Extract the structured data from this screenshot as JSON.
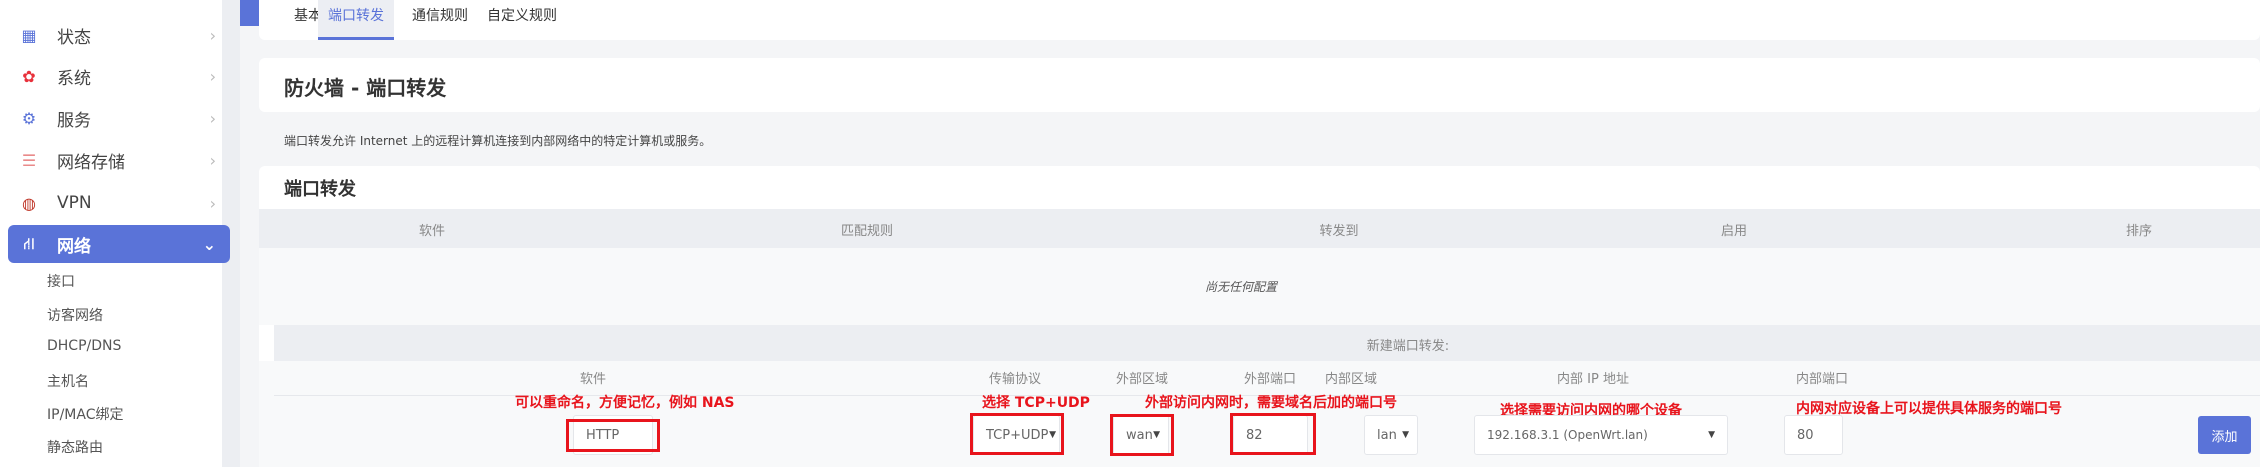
{
  "sidebar": {
    "items": [
      {
        "label": "状态",
        "icon": "dashboard-icon",
        "color": "#5a73d8"
      },
      {
        "label": "系统",
        "icon": "gear-icon",
        "color": "#e8313b"
      },
      {
        "label": "服务",
        "icon": "services-icon",
        "color": "#5a73d8"
      },
      {
        "label": "网络存储",
        "icon": "storage-icon",
        "color": "#e98a8a"
      },
      {
        "label": "VPN",
        "icon": "vpn-icon",
        "color": "#c0392b"
      },
      {
        "label": "网络",
        "icon": "network-icon",
        "color": "#ffffff"
      }
    ],
    "subitems": [
      "接口",
      "访客网络",
      "DHCP/DNS",
      "主机名",
      "IP/MAC绑定",
      "静态路由"
    ]
  },
  "tabs": [
    "基本设置",
    "端口转发",
    "通信规则",
    "自定义规则"
  ],
  "page_title": "防火墙 - 端口转发",
  "description": "端口转发允许 Internet 上的远程计算机连接到内部网络中的特定计算机或服务。",
  "section_title": "端口转发",
  "table": {
    "headers": [
      "软件",
      "匹配规则",
      "转发到",
      "启用",
      "排序"
    ],
    "empty_text": "尚无任何配置"
  },
  "new_form": {
    "title": "新建端口转发:",
    "headers": [
      "软件",
      "传输协议",
      "外部区域",
      "外部端口",
      "内部区域",
      "内部 IP 地址",
      "内部端口"
    ],
    "name": "HTTP",
    "protocol": "TCP+UDP",
    "src_zone": "wan",
    "ext_port": "82",
    "dest_zone": "lan",
    "int_ip": "192.168.3.1 (OpenWrt.lan)",
    "int_port": "80",
    "add_label": "添加"
  },
  "annotations": [
    "可以重命名，方便记忆，例如 NAS",
    "选择 TCP+UDP",
    "外部访问内网时，需要域名后加的端口号",
    "选择需要访问内网的哪个设备",
    "内网对应设备上可以提供具体服务的端口号"
  ],
  "colors": {
    "accent": "#5a73d8",
    "annotation": "#e8141c"
  }
}
